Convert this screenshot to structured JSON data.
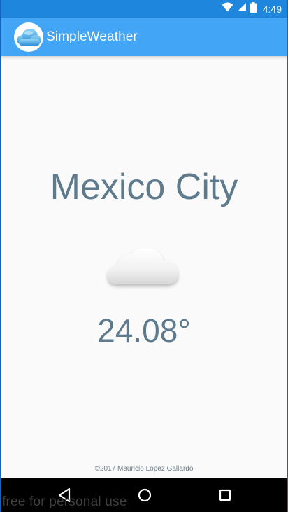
{
  "status_bar": {
    "time": "4:49",
    "icons": [
      "wifi-icon",
      "signal-icon",
      "battery-icon"
    ]
  },
  "app_bar": {
    "title": "SimpleWeather",
    "logo_icon": "cloud-logo-icon",
    "background_color": "#42a5f5"
  },
  "weather": {
    "city": "Mexico City",
    "condition_icon": "cloud-icon",
    "temperature": "24.08°"
  },
  "footer": {
    "copyright": "©2017 Mauricio Lopez Gallardo"
  },
  "nav_bar": {
    "buttons": [
      "back-icon",
      "home-icon",
      "recent-apps-icon"
    ]
  },
  "watermark": {
    "text": "free for personal use"
  },
  "colors": {
    "status_bar": "#1f86dd",
    "app_bar": "#42a5f5",
    "text_primary": "#5e7a8d"
  }
}
